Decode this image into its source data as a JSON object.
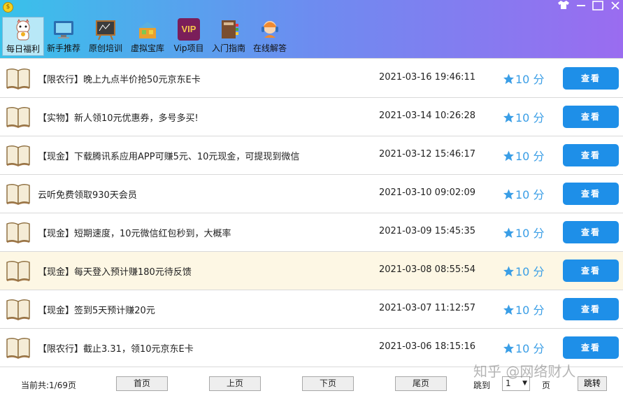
{
  "toolbar": {
    "items": [
      {
        "label": "每日福利",
        "icon": "lucky-cat-icon"
      },
      {
        "label": "新手推荐",
        "icon": "monitor-icon"
      },
      {
        "label": "原创培训",
        "icon": "blackboard-icon"
      },
      {
        "label": "虚拟宝库",
        "icon": "treasure-box-icon"
      },
      {
        "label": "Vip项目",
        "icon": "vip-icon",
        "icon_text": "VIP"
      },
      {
        "label": "入门指南",
        "icon": "guide-book-icon"
      },
      {
        "label": "在线解答",
        "icon": "support-agent-icon"
      }
    ]
  },
  "list": {
    "items": [
      {
        "title": "【限农行】晚上九点半价抢50元京东E卡",
        "date": "2021-03-16  19:46:11",
        "score": "10 分",
        "button": "查看"
      },
      {
        "title": "【实物】新人领10元优惠券，多号多买!",
        "date": "2021-03-14  10:26:28",
        "score": "10 分",
        "button": "查看"
      },
      {
        "title": "【现金】下载腾讯系应用APP可赚5元、10元现金，可提现到微信",
        "date": "2021-03-12  15:46:17",
        "score": "10 分",
        "button": "查看"
      },
      {
        "title": "云听免费领取930天会员",
        "date": "2021-03-10  09:02:09",
        "score": "10 分",
        "button": "查看"
      },
      {
        "title": "【现金】短期速度，10元微信红包秒到，大概率",
        "date": "2021-03-09  15:45:35",
        "score": "10 分",
        "button": "查看"
      },
      {
        "title": "【现金】每天登入预计赚180元待反馈",
        "date": "2021-03-08  08:55:54",
        "score": "10 分",
        "button": "查看"
      },
      {
        "title": "【现金】签到5天预计赚20元",
        "date": "2021-03-07  11:12:57",
        "score": "10 分",
        "button": "查看"
      },
      {
        "title": "【限农行】截止3.31，领10元京东E卡",
        "date": "2021-03-06  18:15:16",
        "score": "10 分",
        "button": "查看"
      }
    ]
  },
  "pagination": {
    "info": "当前共:1/69页",
    "first": "首页",
    "prev": "上页",
    "next": "下页",
    "last": "尾页",
    "jump_label": "跳到",
    "page_value": "1",
    "page_unit": "页",
    "jump_button": "跳转"
  },
  "watermark": "知乎 @网络财人",
  "colors": {
    "accent": "#1e8fe8",
    "score": "#3a9ee6",
    "highlight_row": "#fdf7e4"
  }
}
